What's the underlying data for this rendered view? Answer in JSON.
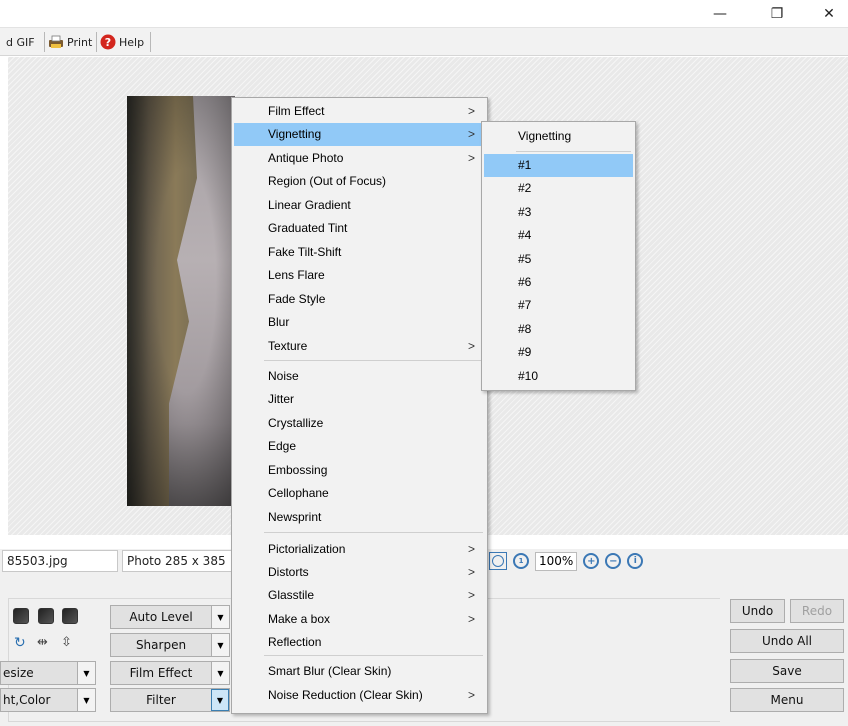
{
  "window": {
    "minimize_glyph": "—",
    "maximize_glyph": "❐",
    "close_glyph": "✕"
  },
  "toolbar": {
    "items": [
      {
        "label": "d GIF",
        "icon": null
      },
      {
        "label": "Print",
        "icon": "print-icon"
      },
      {
        "label": "Help",
        "icon": "help-icon"
      }
    ]
  },
  "status": {
    "filename": "85503.jpg",
    "photo_info": "Photo 285 x 385",
    "zoom": "100%"
  },
  "panel": {
    "auto_level": "Auto Level",
    "sharpen": "Sharpen",
    "film_effect": "Film Effect",
    "filter": "Filter",
    "resize": "esize",
    "light_color": "ht,Color",
    "undo": "Undo",
    "redo": "Redo",
    "undo_all": "Undo All",
    "save": "Save",
    "menu": "Menu"
  },
  "filter_menu": {
    "items": [
      {
        "label": "Film Effect",
        "submenu": true
      },
      {
        "label": "Vignetting",
        "submenu": true,
        "highlighted": true
      },
      {
        "label": "Antique Photo",
        "submenu": true
      },
      {
        "label": "Region (Out of Focus)",
        "submenu": false
      },
      {
        "label": "Linear Gradient",
        "submenu": false
      },
      {
        "label": "Graduated Tint",
        "submenu": false
      },
      {
        "label": "Fake Tilt-Shift",
        "submenu": false
      },
      {
        "label": "Lens Flare",
        "submenu": false
      },
      {
        "label": "Fade Style",
        "submenu": false
      },
      {
        "label": "Blur",
        "submenu": false
      },
      {
        "label": "Texture",
        "submenu": true
      },
      {
        "label": "Noise",
        "submenu": false
      },
      {
        "label": "Jitter",
        "submenu": false
      },
      {
        "label": "Crystallize",
        "submenu": false
      },
      {
        "label": "Edge",
        "submenu": false
      },
      {
        "label": "Embossing",
        "submenu": false
      },
      {
        "label": "Cellophane",
        "submenu": false
      },
      {
        "label": "Newsprint",
        "submenu": false
      },
      {
        "label": "Pictorialization",
        "submenu": true
      },
      {
        "label": "Distorts",
        "submenu": true
      },
      {
        "label": "Glasstile",
        "submenu": true
      },
      {
        "label": "Make a box",
        "submenu": true
      },
      {
        "label": "Reflection",
        "submenu": false
      },
      {
        "label": "Smart Blur (Clear Skin)",
        "submenu": false
      },
      {
        "label": "Noise Reduction (Clear Skin)",
        "submenu": true
      }
    ],
    "arrow": ">"
  },
  "vignetting_submenu": {
    "title": "Vignetting",
    "items": [
      "#1",
      "#2",
      "#3",
      "#4",
      "#5",
      "#6",
      "#7",
      "#8",
      "#9",
      "#10"
    ],
    "highlighted_index": 0
  }
}
